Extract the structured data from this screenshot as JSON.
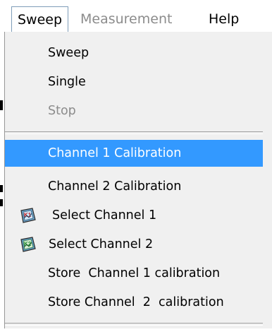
{
  "menubar": {
    "items": [
      {
        "label": "Sweep",
        "state": "active"
      },
      {
        "label": "Measurement",
        "state": "disabled"
      },
      {
        "label": "Help",
        "state": "normal"
      }
    ]
  },
  "dropdown": {
    "items": [
      {
        "label": "Sweep",
        "enabled": true
      },
      {
        "label": "Single",
        "enabled": true
      },
      {
        "label": "Stop",
        "enabled": false
      },
      {
        "label": "Channel 1 Calibration",
        "enabled": true,
        "highlighted": true
      },
      {
        "label": "Channel 2 Calibration",
        "enabled": true
      },
      {
        "label": "Select Channel 1",
        "enabled": true,
        "icon": "channel-1-icon"
      },
      {
        "label": "Select Channel  2",
        "enabled": true,
        "icon": "channel-2-icon"
      },
      {
        "label": "Store  Channel 1 calibration",
        "enabled": true
      },
      {
        "label": "Store Channel  2  calibration",
        "enabled": true
      }
    ]
  },
  "colors": {
    "highlight": "#3399ff",
    "menu_background": "#f0f0f0",
    "disabled_text": "#8c8c8c"
  }
}
